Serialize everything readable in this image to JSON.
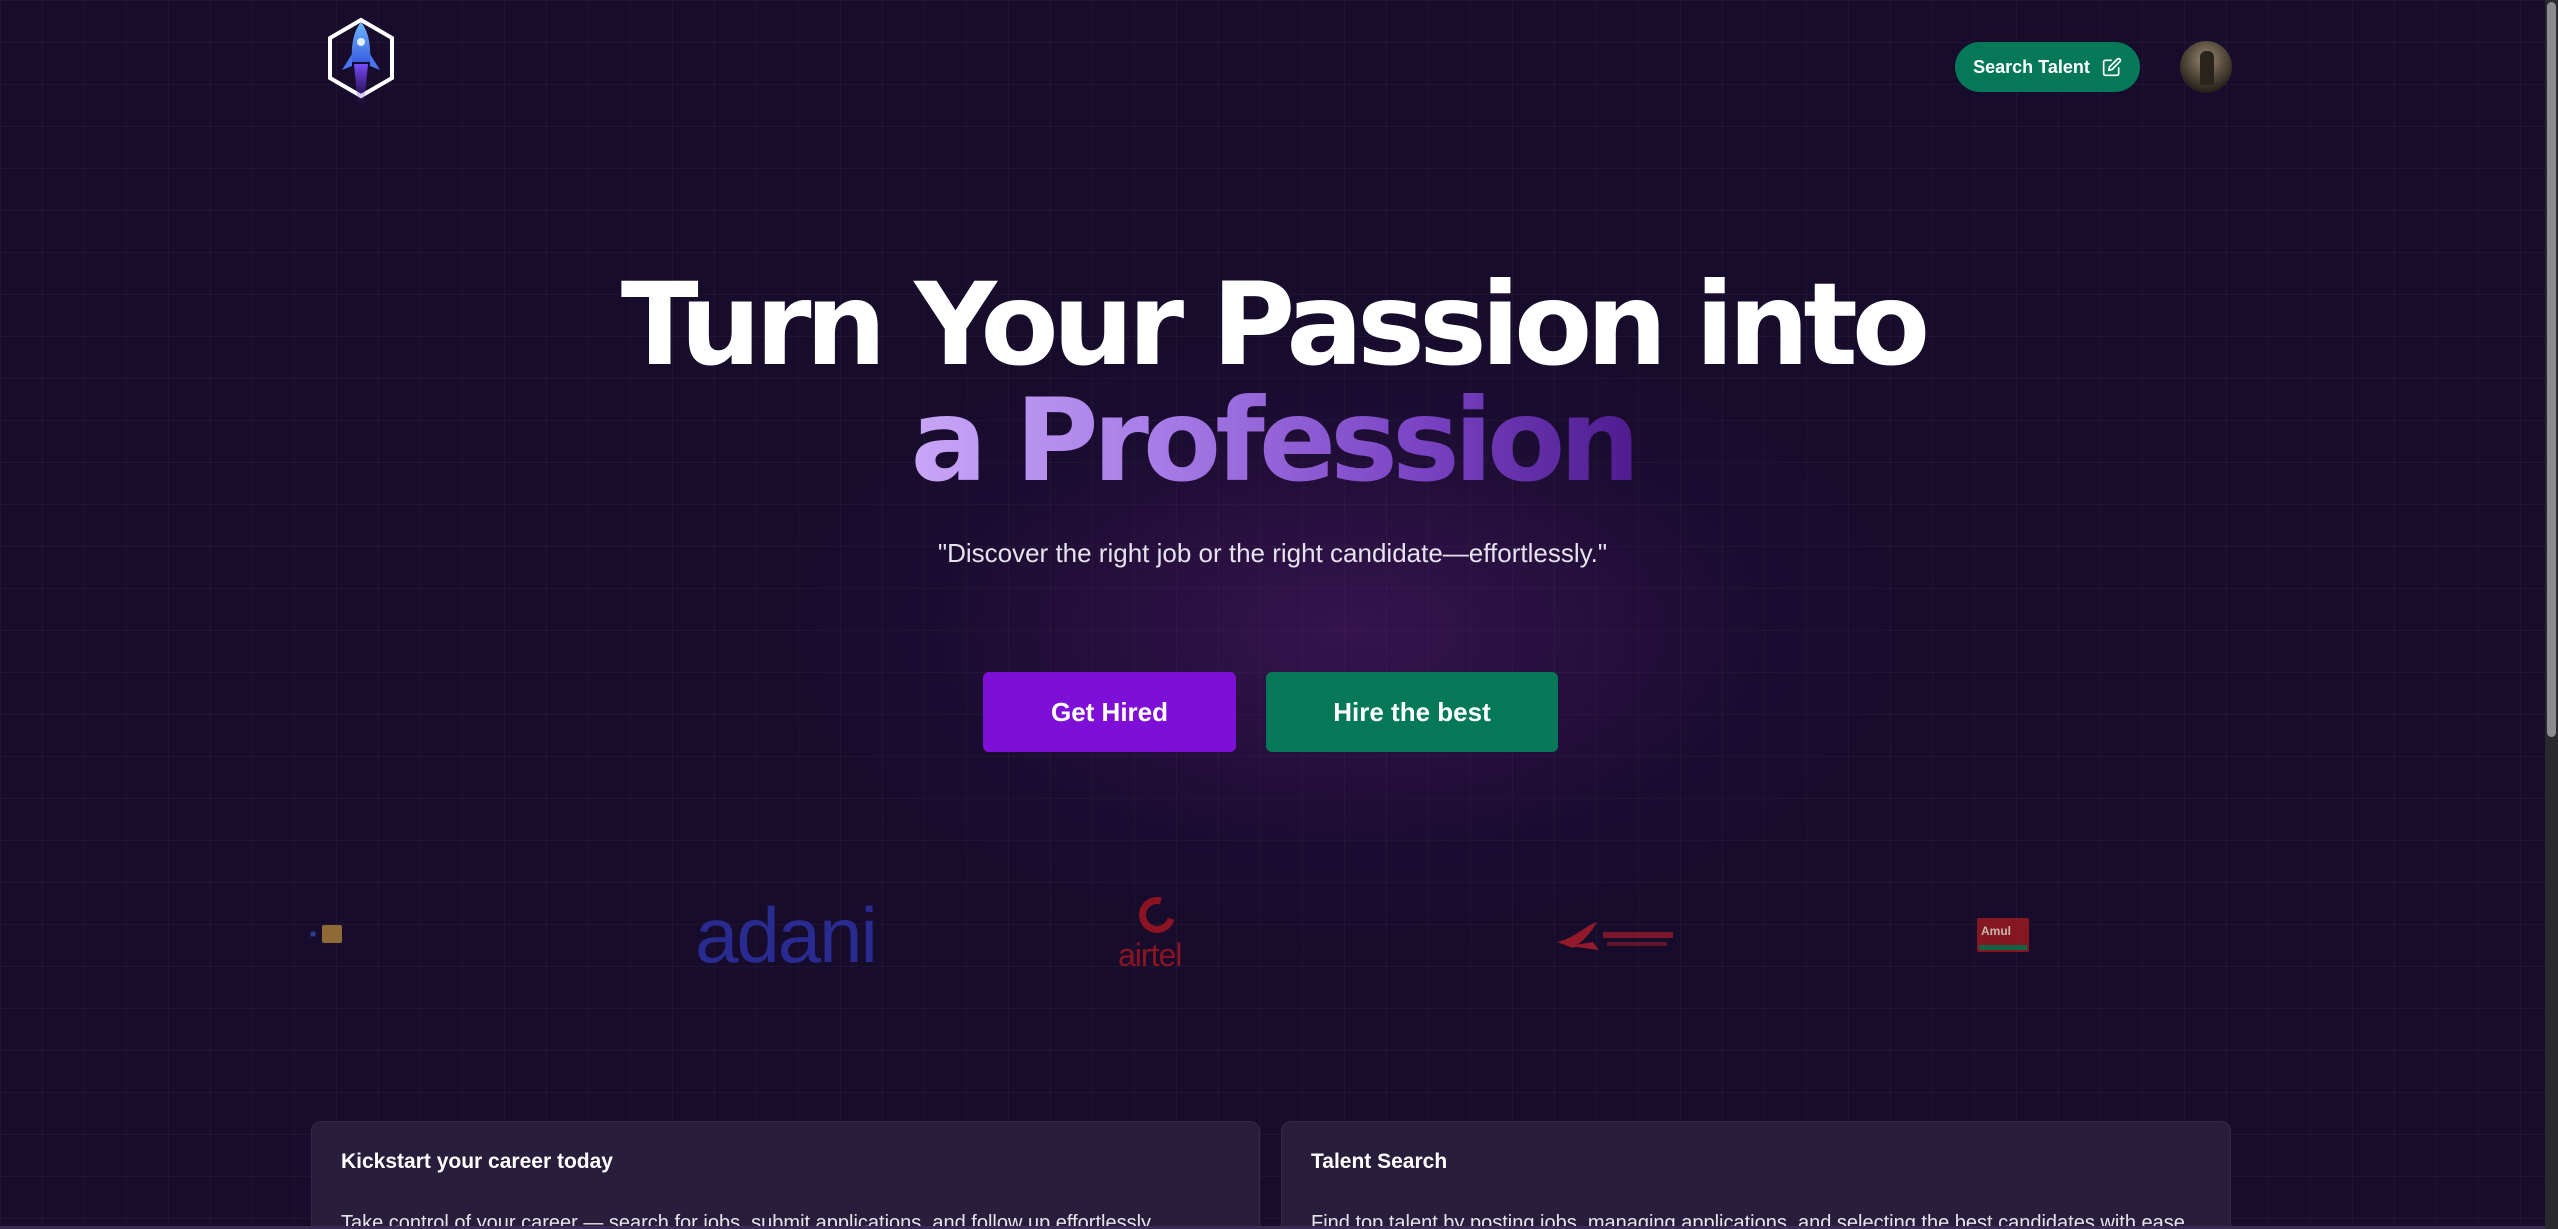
{
  "header": {
    "logo_icon": "rocket-hexagon-icon",
    "search_talent_label": "Search Talent",
    "search_talent_icon": "edit-icon",
    "avatar_icon": "user-avatar"
  },
  "hero": {
    "line1": "Turn Your Passion into",
    "line2": "a Profession",
    "tagline": "\"Discover the right job or the right candidate—effortlessly.\"",
    "primary_button": "Get Hired",
    "secondary_button": "Hire the best"
  },
  "companies": [
    {
      "name": "adani",
      "text": "adani"
    },
    {
      "name": "airtel",
      "text": "airtel"
    },
    {
      "name": "air india",
      "text": ""
    },
    {
      "name": "amul",
      "text": "Amul"
    }
  ],
  "cards": [
    {
      "title": "Kickstart your career today",
      "description": "Take control of your career — search for jobs, submit applications, and follow up effortlessly."
    },
    {
      "title": "Talent Search",
      "description": "Find top talent by posting jobs, managing applications, and selecting the best candidates with ease."
    }
  ],
  "colors": {
    "background": "#170c2b",
    "brand_green": "#047857",
    "brand_purple": "#7e0fd6",
    "card_bg": "#281d3b"
  }
}
